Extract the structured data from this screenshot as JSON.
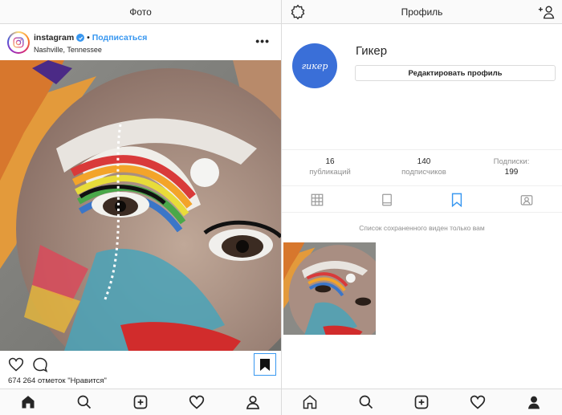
{
  "left_screen": {
    "title": "Фото",
    "post": {
      "username": "instagram",
      "dot": "•",
      "follow_label": "Подписаться",
      "location": "Nashville, Tennessee",
      "more_label": "•••",
      "likes_text": "674 264 отметок \"Нравится\"",
      "saved": true
    },
    "icons": {
      "like": "heart-icon",
      "comment": "comment-icon",
      "bookmark": "bookmark-filled-icon"
    }
  },
  "right_screen": {
    "title": "Профиль",
    "profile": {
      "avatar_text": "гикер",
      "name": "Гикер",
      "edit_label": "Редактировать профиль"
    },
    "stats": {
      "posts": {
        "value": "16",
        "label": "публикаций"
      },
      "followers": {
        "value": "140",
        "label": "подписчиков"
      },
      "following": {
        "value": "199",
        "label": "Подписки:"
      }
    },
    "tabs": [
      "grid-icon",
      "list-icon",
      "bookmark-icon",
      "tagged-icon"
    ],
    "active_tab": "bookmark-icon",
    "saved_note": "Список сохраненного виден только вам"
  },
  "bottom_nav": [
    "home-icon",
    "search-icon",
    "add-icon",
    "heart-icon",
    "profile-icon"
  ],
  "colors": {
    "link_blue": "#3897f0",
    "avatar_blue": "#3a6fd8",
    "text": "#262626",
    "muted": "#8e8e8e",
    "border": "#dbdbdb"
  }
}
